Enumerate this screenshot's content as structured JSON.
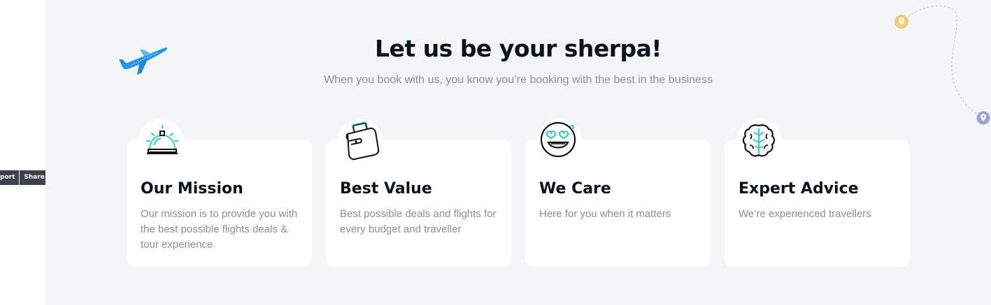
{
  "toolbar": {
    "report_label": "port",
    "share_label": "Share"
  },
  "section": {
    "title": "Let us be your sherpa!",
    "subtitle": "When you book with us, you know you’re booking with the best in the business"
  },
  "cards": [
    {
      "title": "Our Mission",
      "text": "Our mission is to provide you with the best possible flights deals & tour experience",
      "icon": "service-bell-icon"
    },
    {
      "title": "Best Value",
      "text": "Best possible deals and flights for every budget and traveller",
      "icon": "wallet-icon"
    },
    {
      "title": "We Care",
      "text": "Here for you when it matters",
      "icon": "heart-eyes-smiley-icon"
    },
    {
      "title": "Expert Advice",
      "text": "We’re experienced travellers",
      "icon": "brain-icon"
    }
  ],
  "colors": {
    "accent_teal": "#2ecfc7",
    "plane_blue": "#2196f3",
    "pin_orange": "#f7c77a",
    "pin_purple": "#9aa3d6",
    "heading": "#0b1320",
    "muted_text": "#8a8f98",
    "section_bg": "#f4f5f7"
  },
  "decorations": {
    "plane": "airplane-icon",
    "route_start": "map-pin-icon",
    "route_end": "map-pin-icon"
  }
}
